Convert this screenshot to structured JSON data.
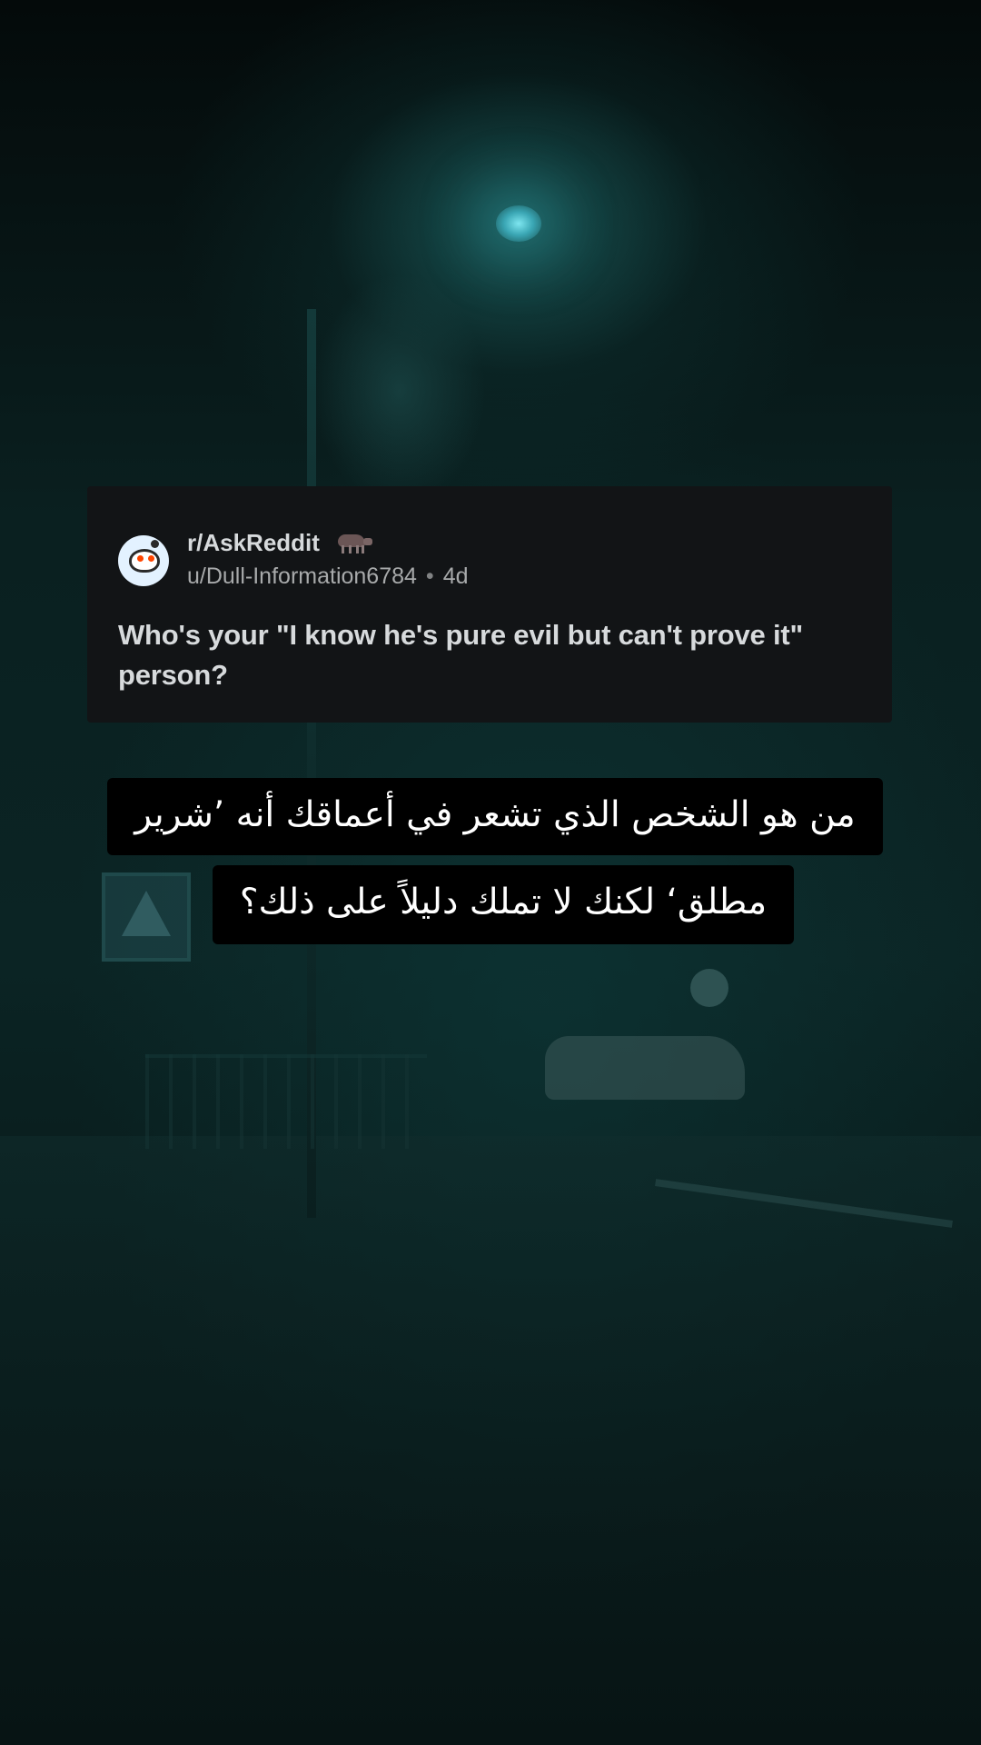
{
  "post": {
    "subreddit": "r/AskReddit",
    "user": "u/Dull-Information6784",
    "separator": "•",
    "age": "4d",
    "title": "Who's your \"I know he's pure evil but can't prove it\" person?"
  },
  "caption": {
    "line1": "من هو الشخص الذي تشعر في أعماقك أنه ’شرير",
    "line2": "مطلق‘ لكنك لا تملك دليلاً على ذلك؟"
  },
  "icons": {
    "avatar": "reddit-snoo-avatar",
    "subreddit_badge": "animal-icon"
  },
  "colors": {
    "card_background": "#121416",
    "text_primary": "#d7dadc",
    "text_secondary": "#a8aaab",
    "caption_background": "#000000",
    "caption_text": "#ffffff"
  }
}
